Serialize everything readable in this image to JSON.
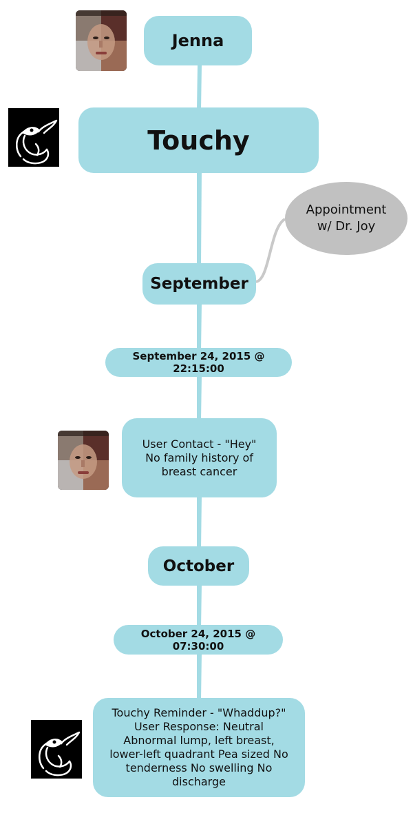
{
  "nodes": {
    "user_name": "Jenna",
    "app_title": "Touchy",
    "month_1": "September",
    "date_1": "September 24, 2015 @ 22:15:00",
    "note_1": [
      "User Contact - \"Hey\"",
      "No family history of",
      "breast cancer"
    ],
    "month_2": "October",
    "date_2": "October 24, 2015 @ 07:30:00",
    "note_2": [
      "Touchy Reminder - \"Whaddup?\"",
      "User Response: Neutral",
      "Abnormal lump, left breast,",
      "lower-left quadrant   Pea sized   No",
      "tenderness   No swelling   No",
      "discharge"
    ]
  },
  "callout": {
    "lines": [
      "Appointment",
      "w/ Dr. Joy"
    ]
  },
  "colors": {
    "node_fill": "#a3dbe4",
    "connector": "#a3dbe4",
    "callout_fill": "#c1c1c1",
    "callout_connector": "#c9c9c9"
  },
  "icons": {
    "user": "user-face-icon",
    "app": "elephant-icon"
  }
}
